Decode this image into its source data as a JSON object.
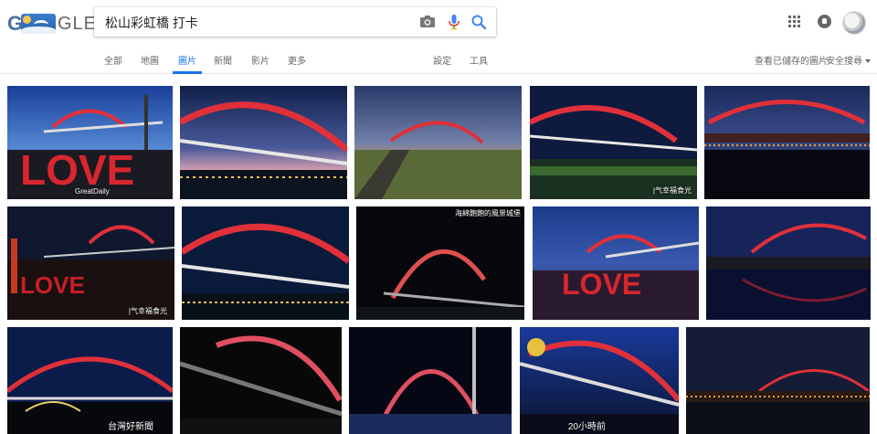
{
  "logo": {
    "letter_left": "G",
    "letters_right": "GLE"
  },
  "search": {
    "value": "松山彩虹橋 打卡"
  },
  "tabs": {
    "all": "全部",
    "maps": "地圖",
    "images": "圖片",
    "news": "新聞",
    "videos": "影片",
    "more": "更多",
    "settings": "設定",
    "tools": "工具",
    "saved": "查看已儲存的圖片",
    "safe_search": "安全搜尋"
  },
  "images": {
    "r1c1": "GreatDaily",
    "r1c4": "|气幸福食光",
    "r2c1": "|气幸福食光",
    "r2c3": "海綿飽飽的風景城堡",
    "r3c2": "台灣好新聞",
    "r3c4": "20小時前"
  },
  "colors": {
    "accent": "#1a73e8",
    "bridge_red": "#e0303a",
    "night_sky": "#0c1a3a"
  }
}
